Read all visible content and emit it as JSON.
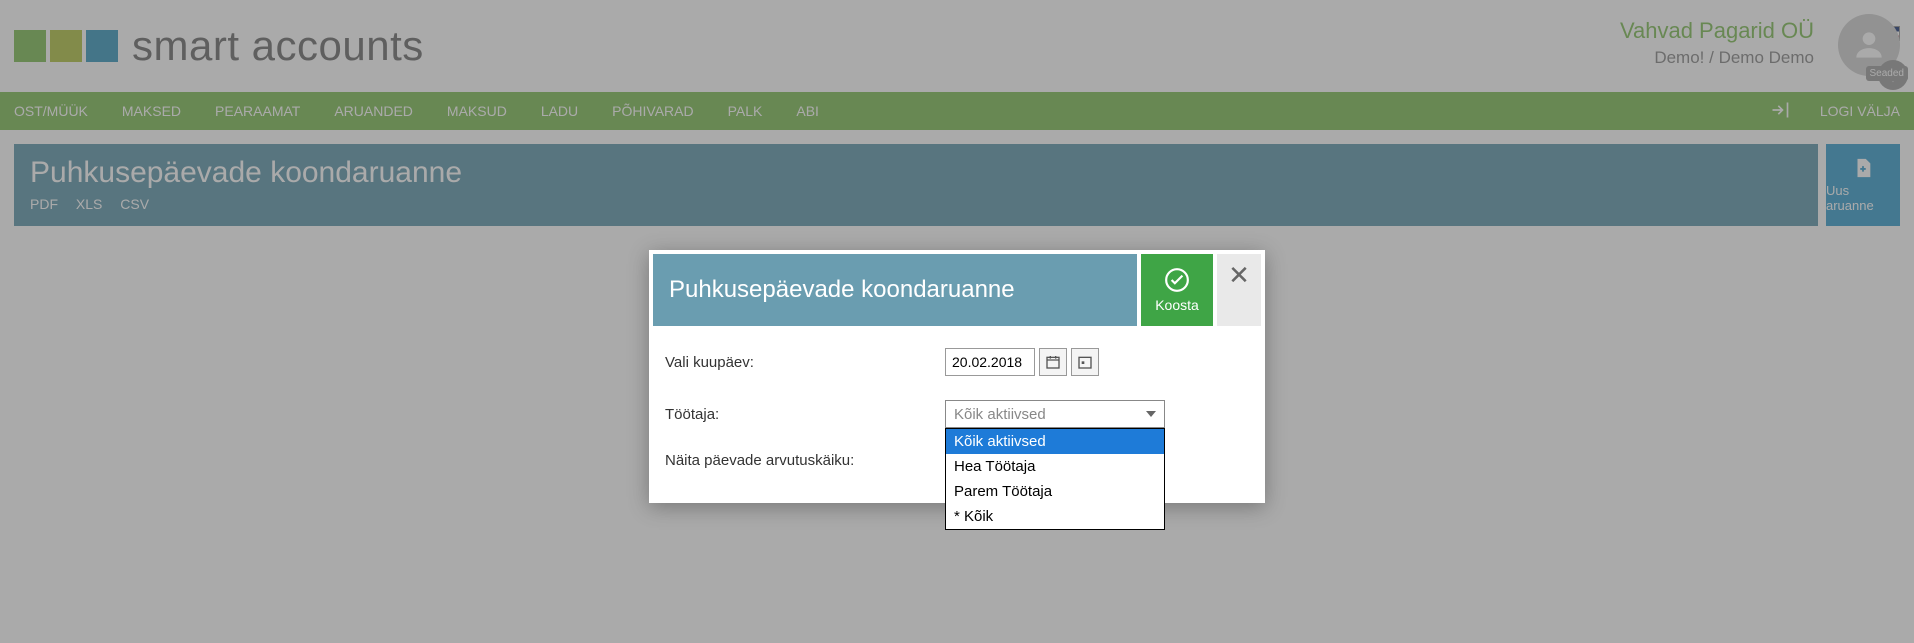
{
  "header": {
    "logo_text": "smart accounts",
    "company_name": "Vahvad Pagarid OÜ",
    "company_sub": "Demo! / Demo Demo",
    "settings_label": "Seaded"
  },
  "nav": {
    "items": [
      "OST/MÜÜK",
      "MAKSED",
      "PEARAAMAT",
      "ARUANDED",
      "MAKSUD",
      "LADU",
      "PÕHIVARAD",
      "PALK",
      "ABI"
    ],
    "logout": "LOGI VÄLJA"
  },
  "page": {
    "title": "Puhkusepäevade koondaruanne",
    "export_links": [
      "PDF",
      "XLS",
      "CSV"
    ],
    "new_report": "Uus aruanne"
  },
  "modal": {
    "title": "Puhkusepäevade koondaruanne",
    "build_label": "Koosta",
    "date_label": "Vali kuupäev:",
    "date_value": "20.02.2018",
    "employee_label": "Töötaja:",
    "employee_placeholder": "Kõik aktiivsed",
    "employee_options": [
      "Kõik aktiivsed",
      "Hea Töötaja",
      "Parem Töötaja",
      "* Kõik"
    ],
    "show_calc_label": "Näita päevade arvutuskäiku:"
  }
}
